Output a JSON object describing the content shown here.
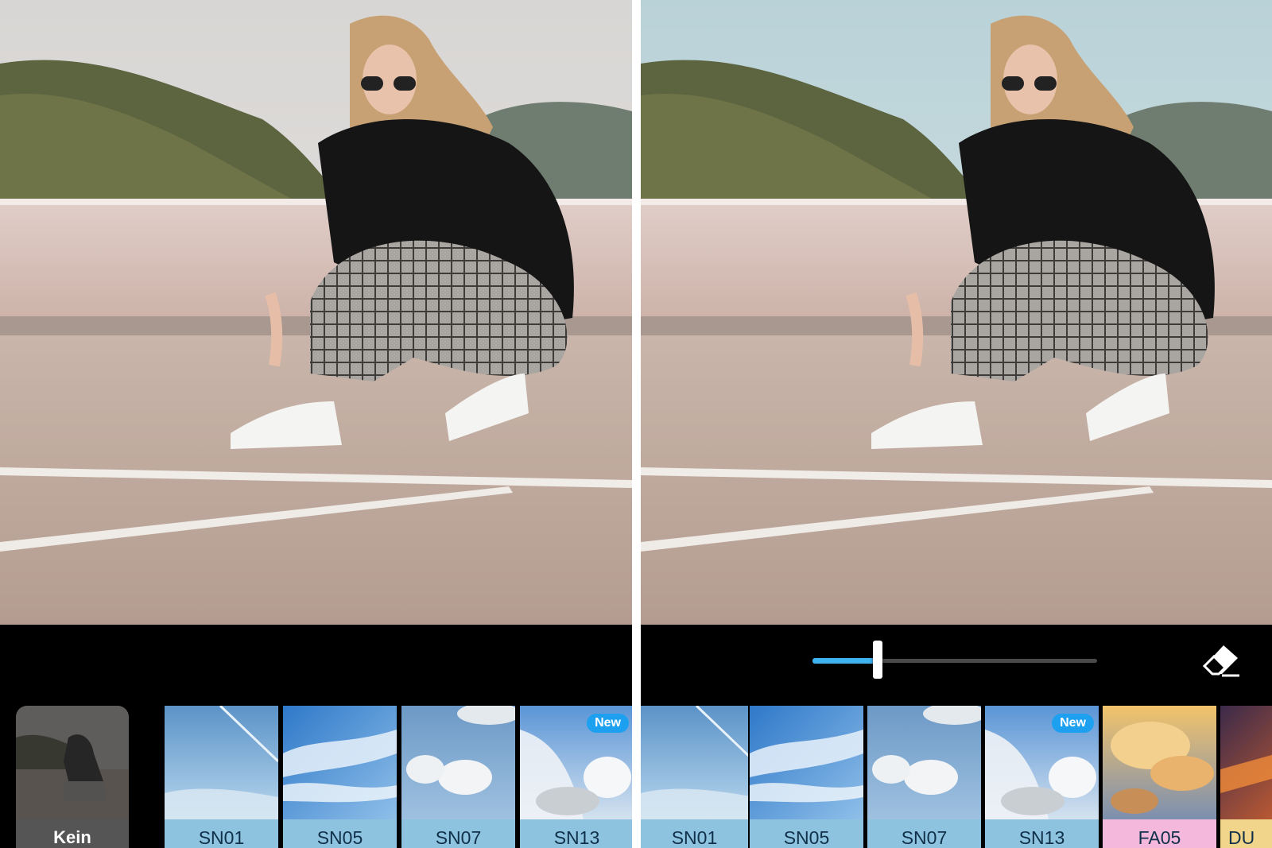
{
  "left_panel": {
    "filters": [
      {
        "label": "Kein",
        "selected": true
      },
      {
        "label": "SN01"
      },
      {
        "label": "SN05"
      },
      {
        "label": "SN07"
      },
      {
        "label": "SN13",
        "badge": "New"
      }
    ]
  },
  "right_panel": {
    "intensity": {
      "value_percent": 23
    },
    "filters": [
      {
        "label": "SN01"
      },
      {
        "label": "SN05"
      },
      {
        "label": "SN07"
      },
      {
        "label": "SN13",
        "badge": "New"
      },
      {
        "label": "FA05"
      },
      {
        "label": "DU"
      }
    ],
    "eraser_icon": "eraser-icon"
  },
  "colors": {
    "sky_label": "#8ec3df",
    "sunset_label_pink": "#f3b8dc",
    "last_label_yellow": "#f1d58a",
    "slider_fill": "#3fb3f0",
    "badge": "#1ea0f0"
  }
}
